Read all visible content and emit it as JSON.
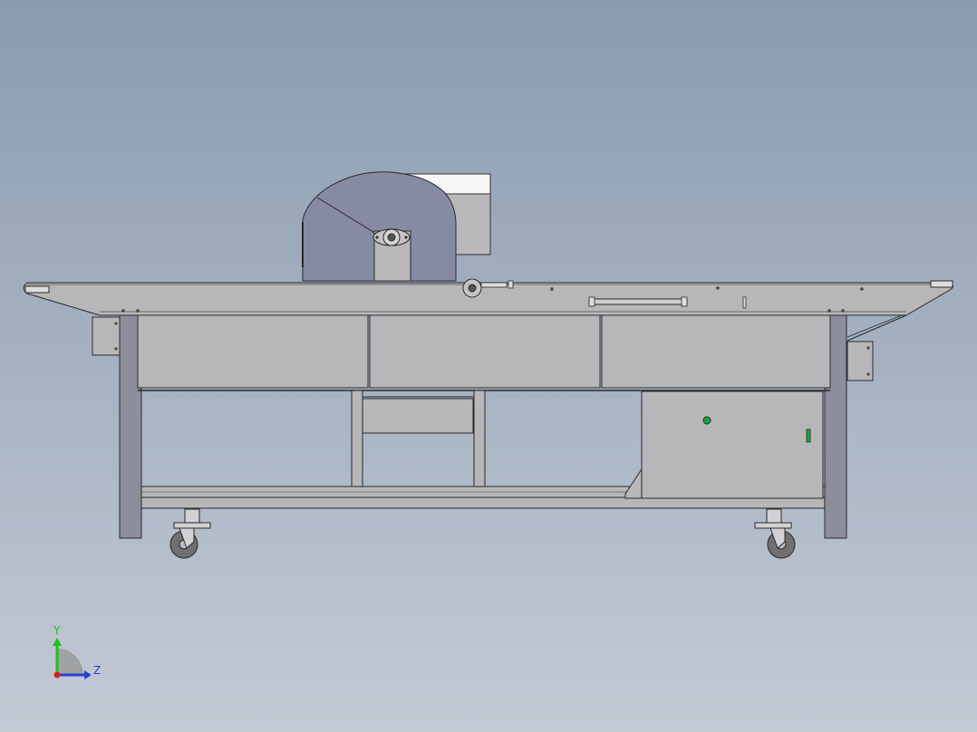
{
  "view": {
    "background_top": "#8a9bb0",
    "background_bottom": "#c4cad4"
  },
  "colors": {
    "panel_fill": "#b7b7b9",
    "frame_fill": "#8d8e9c",
    "saw_hood_fill": "#878aa3",
    "white_panel": "#f4f4f4",
    "wheel_fill": "#6f6f74",
    "edge": "#2a2a2a",
    "indicator_green": "#18a83a"
  },
  "triad": {
    "y_label": "Y",
    "z_label": "Z",
    "y_color": "#1fbf1f",
    "z_color": "#2a3fd0",
    "x_color": "#d01f1f"
  }
}
